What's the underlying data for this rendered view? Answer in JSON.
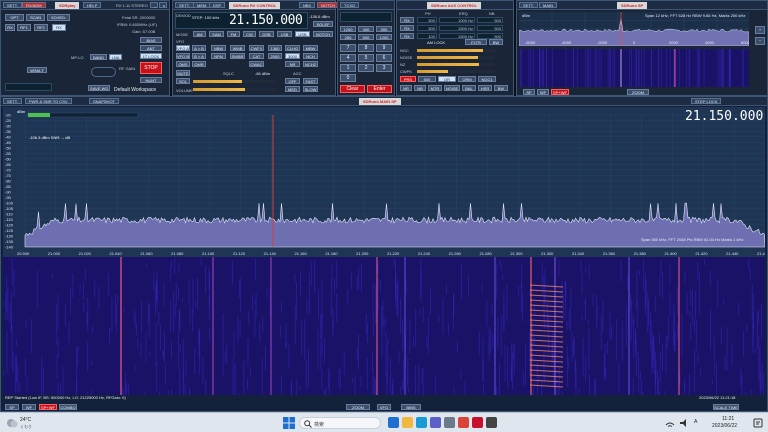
{
  "main_panel": {
    "tabs": [
      "SETT.",
      "RX/ADM",
      "SDRplay"
    ],
    "btn_right": "RX 1.11 STEREO",
    "row1": [
      "OPT",
      "SCAN",
      "SCHED.",
      "FILE"
    ],
    "row2": [
      "RX",
      "RF1",
      "RF2",
      "RX"
    ],
    "info": [
      "Fetal SR: 2000000",
      "IFBW: 0.600MHz (LIF)",
      "Gain: 57.00B"
    ],
    "ls_label": "BAND",
    "adc_label": "LNA",
    "stop": "STOP",
    "lt_label": "LT LOCK",
    "mp_label": "MP-LO",
    "bias": "BIAS",
    "ant": "ANT",
    "hunt": "HUNT",
    "save": "SAVE WS",
    "workspace": "Default Workspace",
    "wsm": "WSM-T"
  },
  "rx_panel": {
    "title": "SDRuno RX CONTROL",
    "tabs": [
      "SETT.",
      "MEM",
      "DSP"
    ],
    "btns": [
      "NBX",
      "NOTCH",
      "SOUN"
    ],
    "readout_label": "DEMOD",
    "step": "STEP: 100 kHz",
    "frequency": "21.150.000",
    "level": "-136.6 dBm",
    "mode_label": "MODE",
    "modes": [
      "AM",
      "SAM",
      "FM",
      "CW",
      "DSB",
      "LSB",
      "USB"
    ],
    "vfo_label": "VFO",
    "modes2": [
      "VFO A",
      "A > B",
      "NBW",
      "WMB",
      "CWFX",
      "1380",
      "CLHG",
      "MBW"
    ],
    "vfo_b": [
      "VFO B",
      "B > A",
      "NFM",
      "SWBR",
      "CAT",
      "2000",
      "3000",
      "NCH"
    ],
    "row4": [
      "QMS",
      "QMR",
      "CWAC",
      "NR",
      "NOISE",
      "NCH2"
    ],
    "agc_label": "AGC",
    "agc": [
      "OFF",
      "FAST",
      "MED",
      "SLOW"
    ],
    "squelch": "SQLC",
    "volume": "VOLUME",
    "sq_value": "-84 dBm",
    "audio_label": "MUTE",
    "ch": [
      "1280",
      "800",
      "400",
      "240",
      "120",
      "60"
    ],
    "mute": "MUTE",
    "sql": "SQL"
  },
  "center_controls": {
    "title": "TCXO",
    "rows": [
      "1200",
      "400",
      "300",
      "250",
      "500",
      "1200"
    ],
    "clear": "Clear",
    "enter": "Enter",
    "num_btns": [
      "7",
      "8",
      "9",
      "4",
      "5",
      "6",
      "1",
      "2",
      "3",
      "0",
      "Clear",
      "Enter"
    ]
  },
  "aux_panel": {
    "title": "SDRuno AUX CONTROL",
    "labels": [
      "PH",
      "ERQ",
      "NB"
    ],
    "vals1": [
      "500",
      "1000 Hz",
      "500"
    ],
    "vals2": [
      "500",
      "1500 Hz",
      "500"
    ],
    "vals3": [
      "100",
      "1500 Hz",
      "500"
    ],
    "levels": [
      "NGC",
      "NOISE",
      "NZ",
      "CWPK"
    ],
    "readouts": [
      "PRS",
      "600",
      "QR",
      "QRM",
      "NGC1"
    ],
    "bottom": [
      "NR",
      "NB",
      "MTR",
      "NOISE",
      "BAL",
      "HSR",
      "MNR",
      "BW"
    ],
    "filters": [
      "AM LOCK",
      "RX1",
      "FLTR",
      "BW",
      "0",
      "1",
      "2",
      "3",
      "4"
    ]
  },
  "sp_panel": {
    "title": "SDRuno SP",
    "tabs": [
      "SETT.",
      "MAIN"
    ],
    "readout": "Span 12 kHz, FFT 628 Hz RBW 9.66 Hz, Marks 200 kHz",
    "ticks": [
      "-6000",
      "-4000",
      "-2000",
      "0",
      "2000",
      "4000",
      "6000"
    ],
    "dbm": "dBm",
    "zoom": "ZOOM",
    "sp_buttons": [
      "SP",
      "WF",
      "SP+WF"
    ]
  },
  "main_spectrum": {
    "btn_sett": "SETT.",
    "btn_pwr": "PWR & SNR TO CSV",
    "btn_snap": "SNAPSHOT",
    "btn_lock": "STEP LOCK",
    "title": "SDRuno MAIN SP",
    "frequency": "21.150.000",
    "signal": "-106.3 dBm   SNR: -- dB",
    "db_label": "dBm",
    "db_ticks": [
      "-20",
      "-25",
      "-30",
      "-35",
      "-40",
      "-45",
      "-50",
      "-55",
      "-60",
      "-65",
      "-70",
      "-75",
      "-80",
      "-85",
      "-90",
      "-95",
      "-100",
      "-105",
      "-110",
      "-115",
      "-120",
      "-125",
      "-130",
      "-135",
      "-140"
    ],
    "freq_ticks": [
      "20.900",
      "21.000",
      "21.020",
      "21.040",
      "21.060",
      "21.080",
      "21.100",
      "21.120",
      "21.140",
      "21.160",
      "21.180",
      "21.200",
      "21.220",
      "21.240",
      "21.260",
      "21.280",
      "21.300",
      "21.320",
      "21.340",
      "21.360",
      "21.380",
      "21.400",
      "21.420",
      "21.440",
      "21.460"
    ],
    "span_info": "Span 500 kHz, FFT 2048 Pts RBW 61.04 Hz Marks 1 kHz",
    "status": "REP Started (Low IF, BS: 500000 Hz, LO: 21225000 Hz, RFGain: 0)",
    "datetime": "2023/06/22 11:21:18",
    "bottom_btns": [
      "SP",
      "WF",
      "SP+WF",
      "COMBO"
    ],
    "zoom": "ZOOM",
    "vfo": "VFO",
    "bins": "BINS",
    "scale": "SCALE TIME"
  },
  "taskbar": {
    "weather_temp": "24°C",
    "weather_desc": "くもり",
    "search": "検索",
    "clock_time": "11:21",
    "clock_date": "2023/06/22",
    "input_method": "A"
  },
  "colors": {
    "accent": "#f0b845",
    "red": "#c4121a",
    "spectrum_fill": "#6e6fb0",
    "waterfall_bg": "#1a1266"
  }
}
